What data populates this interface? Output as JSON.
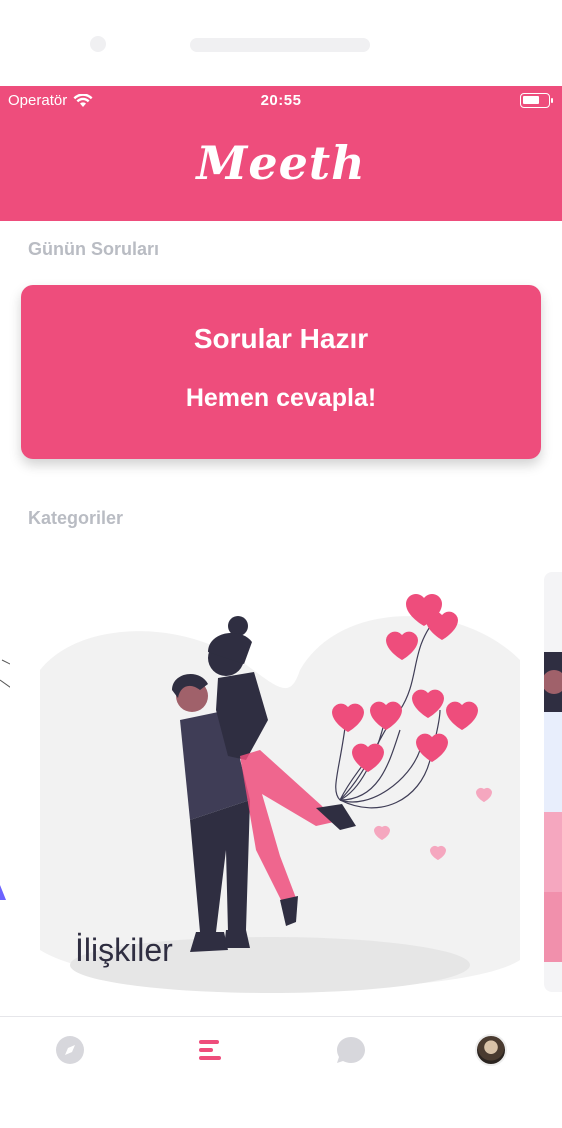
{
  "status_bar": {
    "carrier": "Operatör",
    "time": "20:55"
  },
  "header": {
    "logo": "Meeth"
  },
  "daily": {
    "section_title": "Günün Soruları",
    "card_title": "Sorular Hazır",
    "card_subtitle": "Hemen cevapla!"
  },
  "categories": {
    "section_title": "Kategoriler",
    "items": [
      {
        "label": "İlişkiler"
      }
    ]
  },
  "tab_bar": {
    "items": [
      {
        "icon": "compass-icon",
        "active": false
      },
      {
        "icon": "list-icon",
        "active": true
      },
      {
        "icon": "chat-bubble-icon",
        "active": false
      },
      {
        "icon": "avatar",
        "active": false
      }
    ]
  },
  "colors": {
    "brand": "#ee4d7c",
    "muted_text": "#b9bcc3",
    "tab_inactive": "#d7d7dc",
    "illustration_dark": "#2f2e41"
  }
}
